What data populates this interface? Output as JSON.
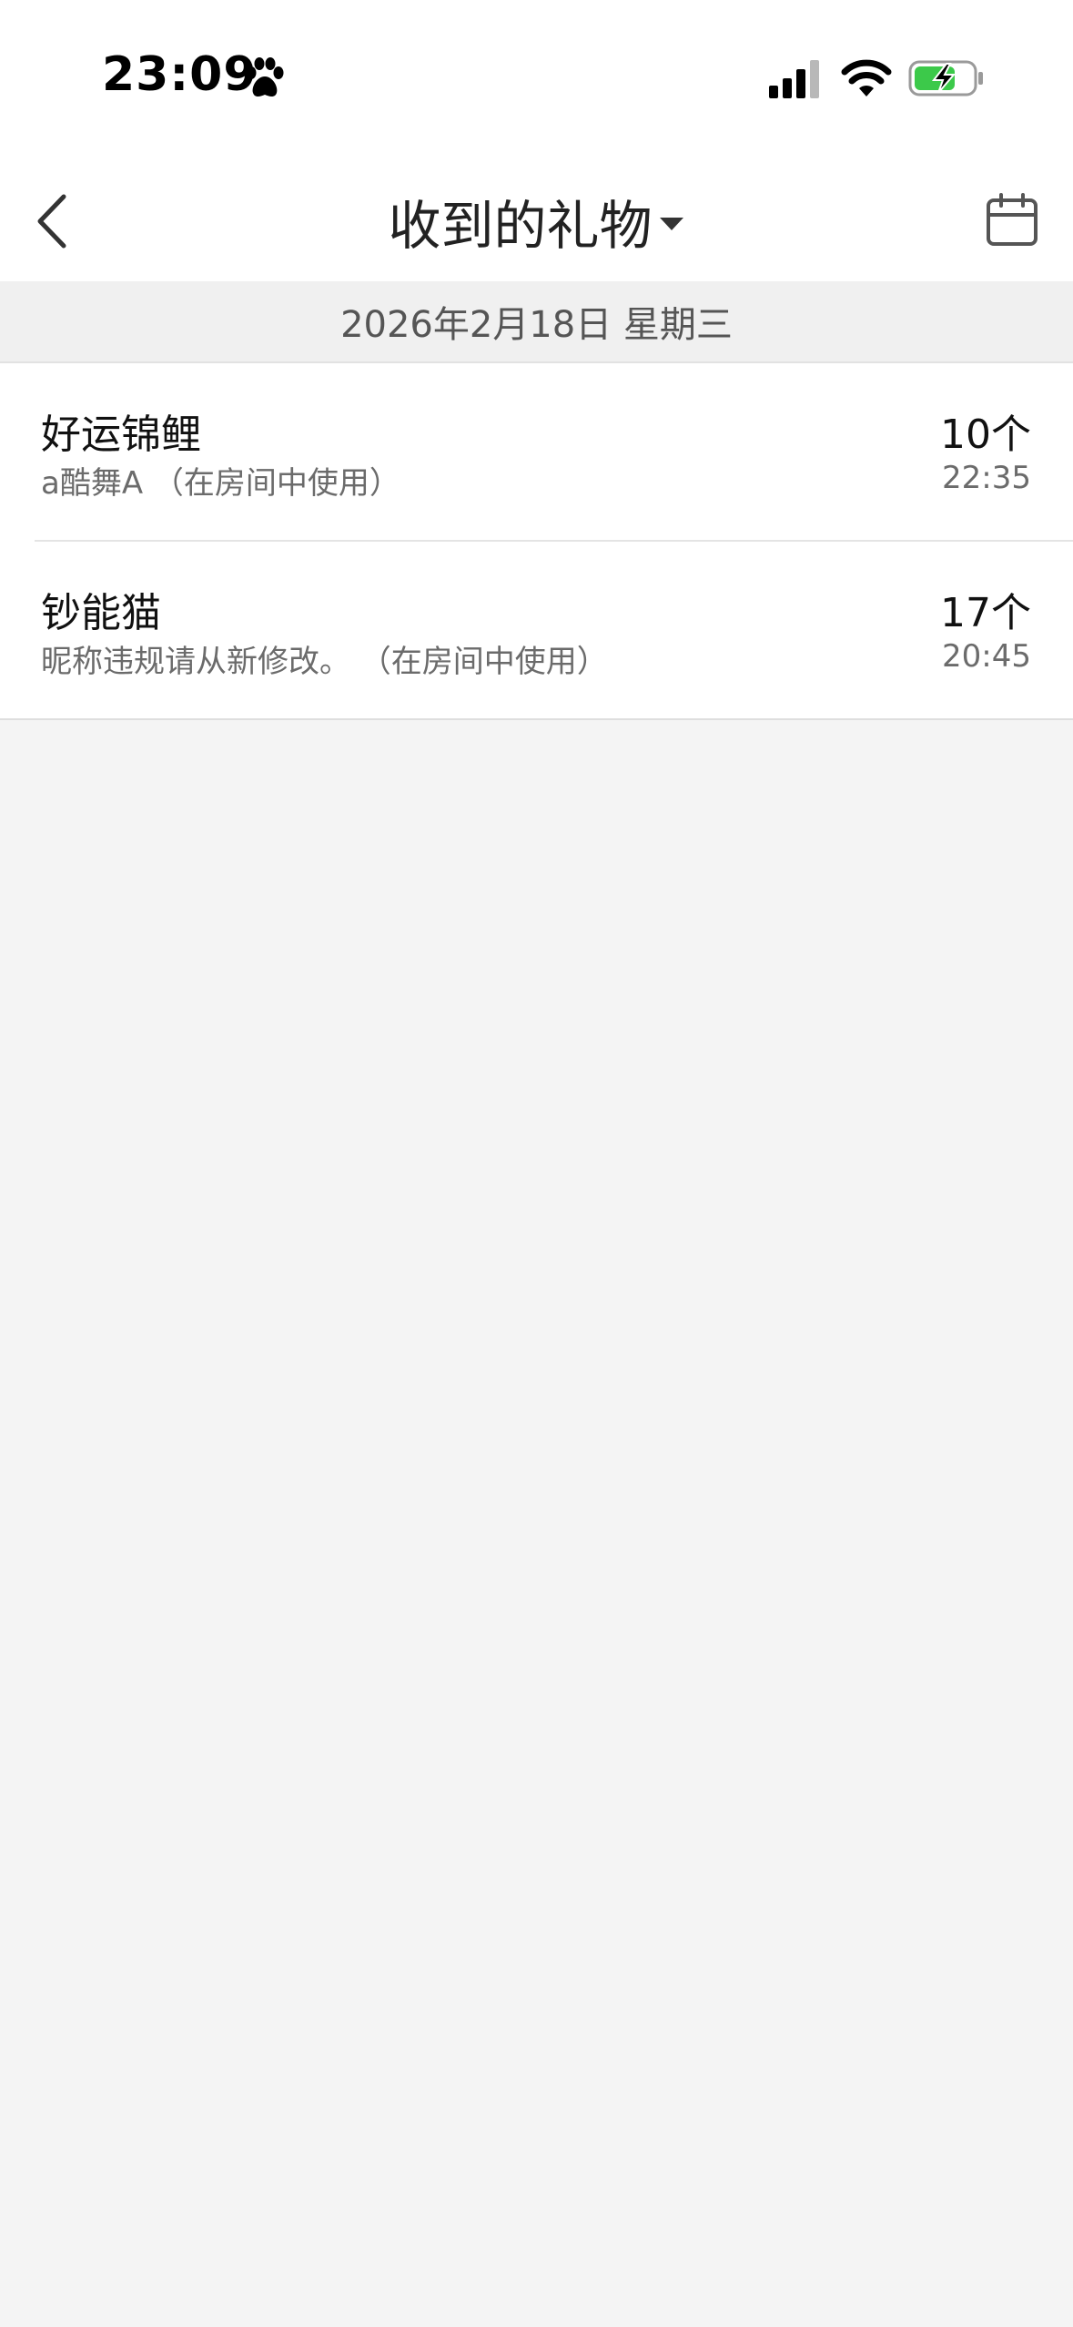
{
  "status_bar": {
    "time": "23:09",
    "icons": [
      "paw-icon",
      "signal-icon",
      "wifi-icon",
      "battery-charging-icon"
    ]
  },
  "nav": {
    "back_icon": "chevron-left-icon",
    "title": "收到的礼物",
    "title_dropdown_icon": "caret-down-icon",
    "calendar_icon": "calendar-icon"
  },
  "date_header": {
    "text": "2026年2月18日 星期三"
  },
  "gifts": [
    {
      "name": "好运锦鲤",
      "sender": "a酷舞A （在房间中使用）",
      "count": "10个",
      "time": "22:35"
    },
    {
      "name": "钞能猫",
      "sender": "昵称违规请从新修改。 （在房间中使用）",
      "count": "17个",
      "time": "20:45"
    }
  ],
  "colors": {
    "battery_green": "#3cc94a",
    "background": "#f4f4f4",
    "nav_background": "#ffffff",
    "date_header_background": "#f0f0f0"
  }
}
